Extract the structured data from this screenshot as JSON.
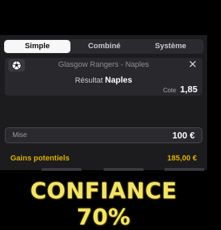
{
  "tabs": [
    {
      "label": "Simple",
      "active": true
    },
    {
      "label": "Combiné",
      "active": false
    },
    {
      "label": "Système",
      "active": false
    }
  ],
  "bet": {
    "sport_icon": "soccer-ball-icon",
    "match": "Glasgow Rangers - Naples",
    "result_label": "Résultat",
    "result_value": "Naples",
    "odds_label": "Cote",
    "odds_value": "1,85",
    "close_icon": "close-icon"
  },
  "stake": {
    "label": "Mise",
    "value": "100 €"
  },
  "winnings": {
    "label": "Gains potentiels",
    "value": "185,00 €"
  },
  "banner": {
    "text": "CONFIANCE 70%"
  },
  "colors": {
    "background": "#1c1c1f",
    "card": "#29292d",
    "accent_gold": "#e0b100",
    "banner_yellow": "#f2e36a",
    "active_tab": "#f7f7f7"
  }
}
